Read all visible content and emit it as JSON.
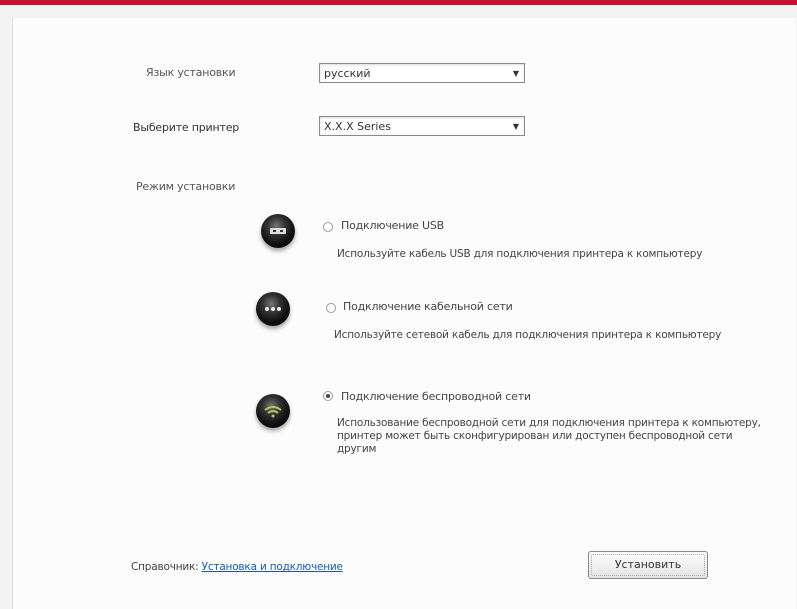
{
  "window": {
    "accent_color": "#c8102e"
  },
  "form": {
    "language_label": "Язык установки",
    "language_value": "русский",
    "printer_label": "Выберите принтер",
    "printer_value": "Х.Х.Х Series",
    "mode_label": "Режим установки"
  },
  "options": [
    {
      "icon": "usb-icon",
      "title": "Подключение USB",
      "description": "Используйте кабель USB для подключения принтера к компьютеру",
      "selected": false
    },
    {
      "icon": "network-icon",
      "title": "Подключение кабельной сети",
      "description": "Используйте сетевой кабель для подключения принтера к компьютеру",
      "selected": false
    },
    {
      "icon": "wireless-icon",
      "title": "Подключение беспроводной сети",
      "description": "Использование беспроводной сети для подключения принтера к компьютеру, принтер может быть сконфигурирован или доступен беспроводной сети другим",
      "selected": true
    }
  ],
  "footer": {
    "prefix": "Справочник:",
    "link": "Установка и подключение",
    "install_button": "Установить"
  }
}
